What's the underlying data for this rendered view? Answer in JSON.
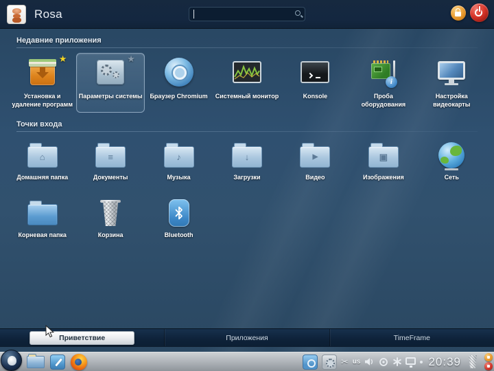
{
  "topbar": {
    "title": "Rosa",
    "search_value": ""
  },
  "sections": {
    "recent_apps": {
      "header": "Недавние приложения",
      "items": [
        {
          "label": "Установка и удаление программ",
          "icon": "package-installer-icon",
          "starred": true
        },
        {
          "label": "Параметры системы",
          "icon": "system-settings-icon",
          "selected": true,
          "starred": true
        },
        {
          "label": "Браузер Chromium",
          "icon": "chromium-icon"
        },
        {
          "label": "Системный монитор",
          "icon": "system-monitor-icon"
        },
        {
          "label": "Konsole",
          "icon": "terminal-icon"
        },
        {
          "label": "Проба оборудования",
          "icon": "hardware-info-icon"
        },
        {
          "label": "Настройка видеокарты",
          "icon": "display-settings-icon"
        }
      ]
    },
    "entry_points": {
      "header": "Точки входа",
      "items": [
        {
          "label": "Домашняя папка",
          "icon": "home-folder-icon"
        },
        {
          "label": "Документы",
          "icon": "documents-folder-icon"
        },
        {
          "label": "Музыка",
          "icon": "music-folder-icon"
        },
        {
          "label": "Загрузки",
          "icon": "downloads-folder-icon"
        },
        {
          "label": "Видео",
          "icon": "video-folder-icon"
        },
        {
          "label": "Изображения",
          "icon": "pictures-folder-icon"
        },
        {
          "label": "Сеть",
          "icon": "network-globe-icon"
        },
        {
          "label": "Корневая папка",
          "icon": "root-folder-icon"
        },
        {
          "label": "Корзина",
          "icon": "trash-icon"
        },
        {
          "label": "Bluetooth",
          "icon": "bluetooth-icon"
        }
      ]
    }
  },
  "tabs": {
    "items": [
      {
        "label": "Приветствие",
        "active": true
      },
      {
        "label": "Приложения",
        "active": false
      },
      {
        "label": "TimeFrame",
        "active": false
      }
    ]
  },
  "taskbar": {
    "clock": "20:39",
    "keyboard_layout": "us"
  },
  "glyphs": {
    "star": "★",
    "info": "i",
    "home": "⌂",
    "documents": "≡",
    "music": "♪",
    "downloads": "↓",
    "video": "▶",
    "pictures": "▣",
    "scissors": "✂"
  },
  "colors": {
    "desktop_bg": "#2f5070",
    "topbar_bg": "#142740",
    "accent_orange": "#ec9f35",
    "accent_red": "#d5382c",
    "selection_border": "#c8dcee",
    "taskbar_bg": "#b2b7bc"
  }
}
